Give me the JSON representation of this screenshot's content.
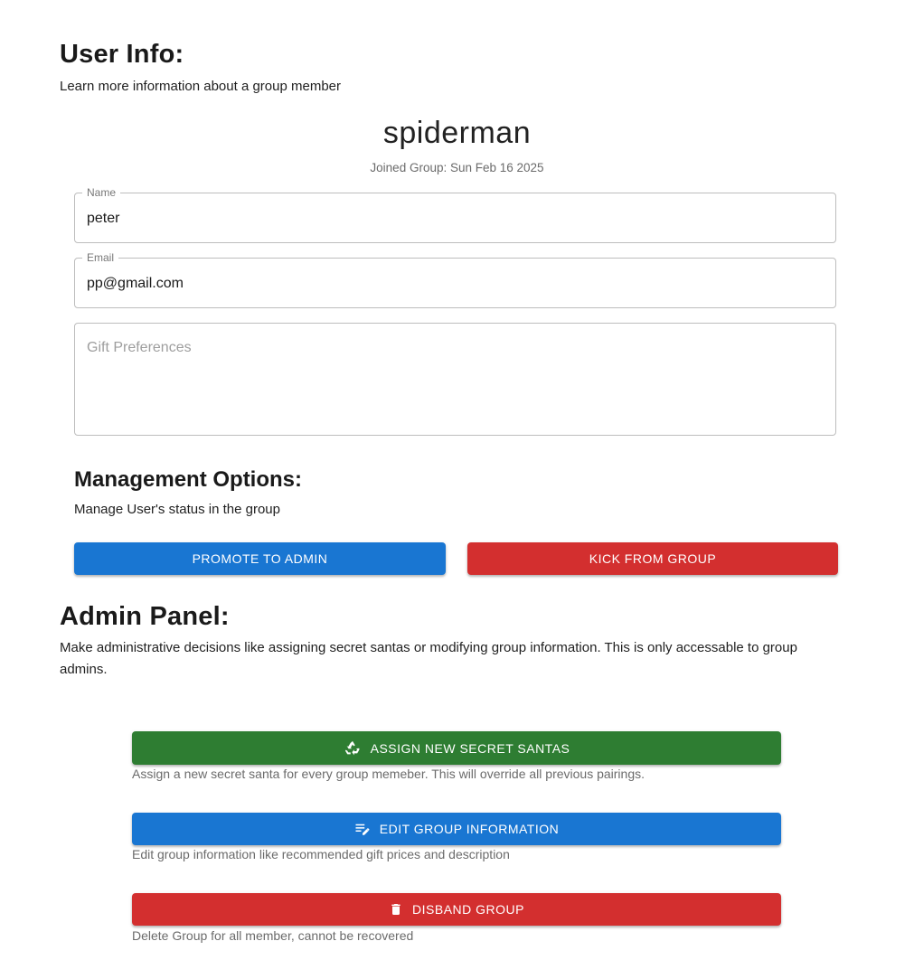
{
  "user_info": {
    "title": "User Info:",
    "subtitle": "Learn more information about a group member",
    "username": "spiderman",
    "joined": "Joined Group: Sun Feb 16 2025",
    "name_label": "Name",
    "name_value": "peter",
    "email_label": "Email",
    "email_value": "pp@gmail.com",
    "gift_placeholder": "Gift Preferences"
  },
  "management": {
    "title": "Management Options:",
    "subtitle": "Manage User's status in the group",
    "promote_label": "PROMOTE TO ADMIN",
    "kick_label": "KICK FROM GROUP"
  },
  "admin_panel": {
    "title": "Admin Panel:",
    "subtitle": "Make administrative decisions like assigning secret santas or modifying group information. This is only accessable to group admins.",
    "actions": [
      {
        "label": "ASSIGN NEW SECRET SANTAS",
        "icon": "recycle-icon",
        "color": "#2e7d32",
        "caption": "Assign a new secret santa for every group memeber. This will override all previous pairings."
      },
      {
        "label": "EDIT GROUP INFORMATION",
        "icon": "edit-note-icon",
        "color": "#1976d2",
        "caption": "Edit group information like recommended gift prices and description"
      },
      {
        "label": "DISBAND GROUP",
        "icon": "trash-icon",
        "color": "#d32f2f",
        "caption": "Delete Group for all member, cannot be recovered"
      }
    ]
  }
}
